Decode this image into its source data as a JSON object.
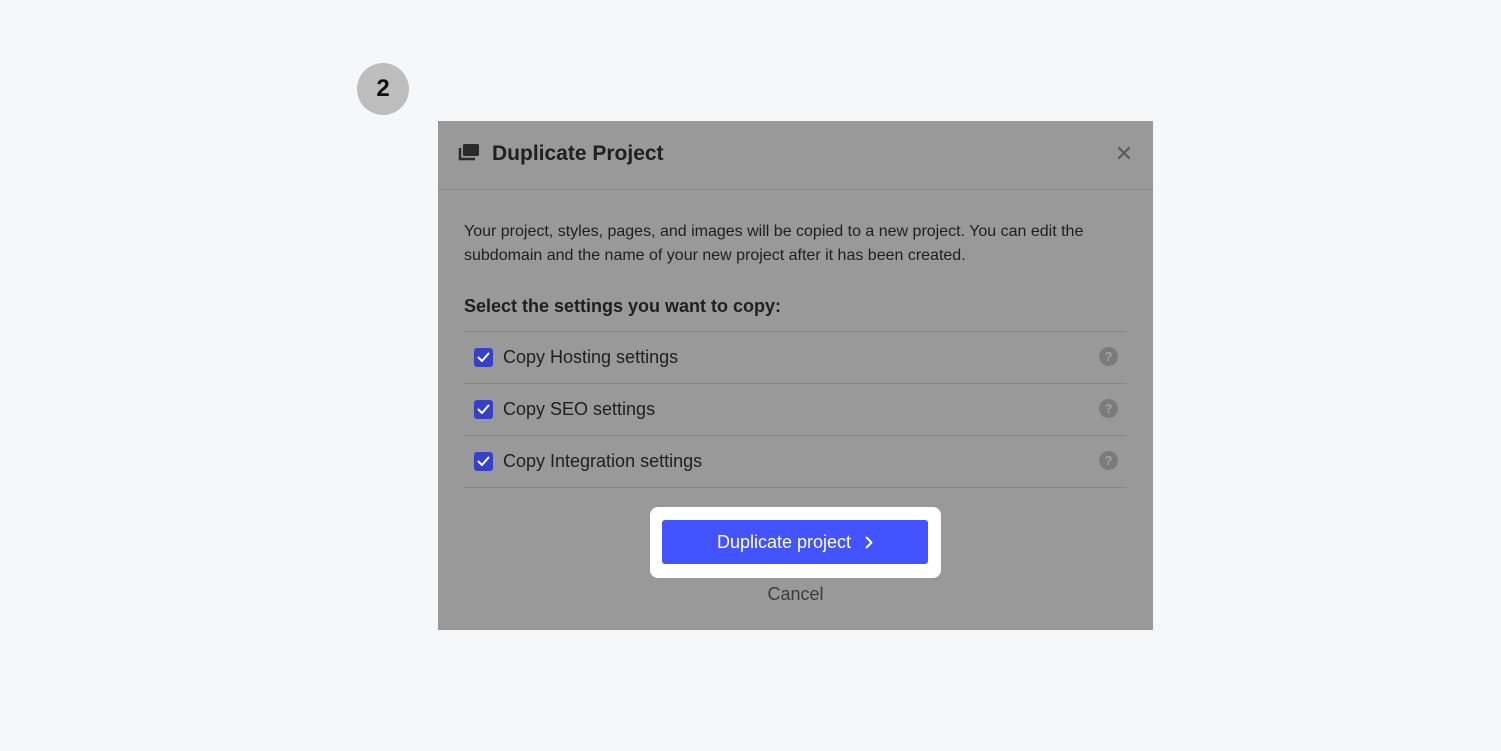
{
  "step": {
    "number": "2"
  },
  "dialog": {
    "title": "Duplicate Project",
    "title_icon": "duplicate-pages-icon",
    "close_icon": "close-icon",
    "description": "Your project, styles, pages, and images will be copied to a new project. You can edit the subdomain and the name of your new project after it has been created.",
    "settings_heading": "Select the settings you want to copy:",
    "settings": [
      {
        "label": "Copy Hosting settings",
        "checked": true,
        "help": "?"
      },
      {
        "label": "Copy SEO settings",
        "checked": true,
        "help": "?"
      },
      {
        "label": "Copy Integration settings",
        "checked": true,
        "help": "?"
      }
    ],
    "primary_button": {
      "label": "Duplicate project",
      "icon": "chevron-right-icon"
    },
    "cancel_label": "Cancel"
  },
  "colors": {
    "page_background": "#f6f7f9",
    "dialog_overlay": "#999999",
    "accent": "#4353ff",
    "checkbox": "#3641c7",
    "step_badge": "#bdbdbd"
  }
}
